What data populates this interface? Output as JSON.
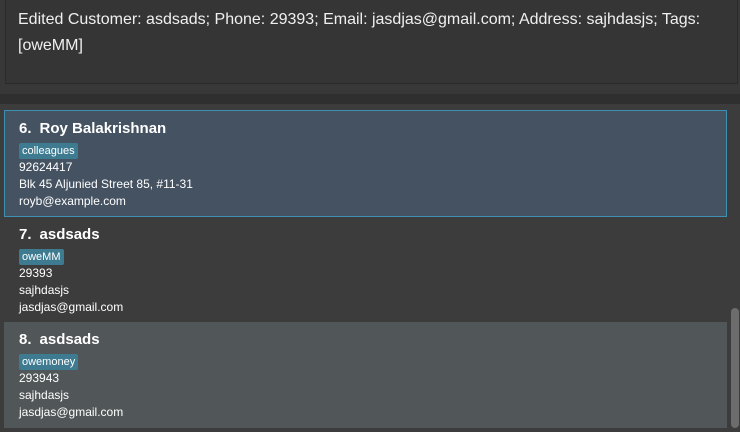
{
  "result": {
    "message": "Edited Customer: asdsads; Phone: 29393; Email: jasdjas@gmail.com; Address: sajhdasjs; Tags: [oweMM]"
  },
  "customers": [
    {
      "index": "6.",
      "name": "Roy Balakrishnan",
      "tag": "colleagues",
      "phone": "92624417",
      "address": "Blk 45 Aljunied Street 85, #11-31",
      "email": "royb@example.com"
    },
    {
      "index": "7.",
      "name": "asdsads",
      "tag": "oweMM",
      "phone": "29393",
      "address": "sajhdasjs",
      "email": "jasdjas@gmail.com"
    },
    {
      "index": "8.",
      "name": "asdsads",
      "tag": "owemoney",
      "phone": "293943",
      "address": "sajhdasjs",
      "email": "jasdjas@gmail.com"
    }
  ],
  "colors": {
    "selected_background": "#445262",
    "selected_border": "#3d8fb3",
    "tag_background": "#3e7b91",
    "panel_background": "#3c3c3c"
  }
}
